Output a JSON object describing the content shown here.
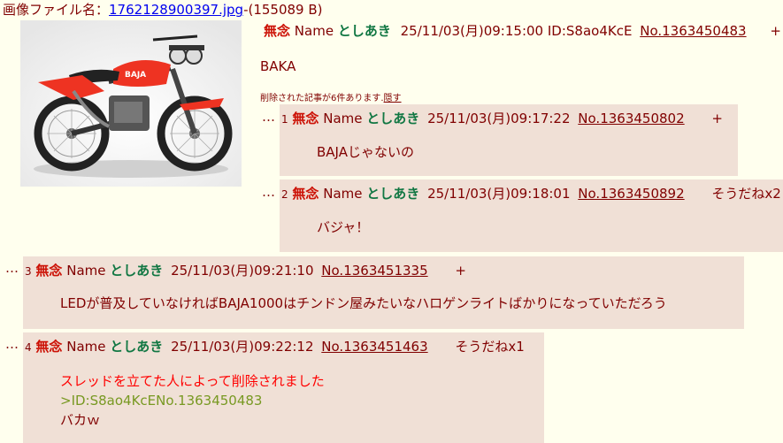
{
  "file": {
    "label": "画像ファイル名：",
    "filename": "1762128900397.jpg",
    "size": "-(155089 B)"
  },
  "op": {
    "subject": "無念",
    "name_label": "Name",
    "name": "としあき",
    "datetime": "25/11/03(月)09:15:00",
    "id": "ID:S8ao4KcE",
    "number": "No.1363450483",
    "plus": "+",
    "body": "BAKA"
  },
  "deleted_note": {
    "text": "削除された記事が6件あります.",
    "hide": "隠す"
  },
  "replies": [
    {
      "dots": "…",
      "index": "1",
      "subject": "無念",
      "name_label": "Name",
      "name": "としあき",
      "datetime": "25/11/03(月)09:17:22",
      "number": "No.1363450802",
      "extra": "+",
      "body": "BAJAじゃないの"
    },
    {
      "dots": "…",
      "index": "2",
      "subject": "無念",
      "name_label": "Name",
      "name": "としあき",
      "datetime": "25/11/03(月)09:18:01",
      "number": "No.1363450892",
      "extra": "そうだねx2",
      "body": "バジャ！"
    },
    {
      "dots": "…",
      "index": "3",
      "subject": "無念",
      "name_label": "Name",
      "name": "としあき",
      "datetime": "25/11/03(月)09:21:10",
      "number": "No.1363451335",
      "extra": "+",
      "body": "LEDが普及していなければBAJA1000はチンドン屋みたいなハロゲンライトばかりになっていただろう"
    },
    {
      "dots": "…",
      "index": "4",
      "subject": "無念",
      "name_label": "Name",
      "name": "としあき",
      "datetime": "25/11/03(月)09:22:12",
      "number": "No.1363451463",
      "extra": "そうだねx1",
      "deleted_msg": "スレッドを立てた人によって削除されました",
      "quote": ">ID:S8ao4KcENo.1363450483",
      "body": "バカｗ"
    }
  ]
}
